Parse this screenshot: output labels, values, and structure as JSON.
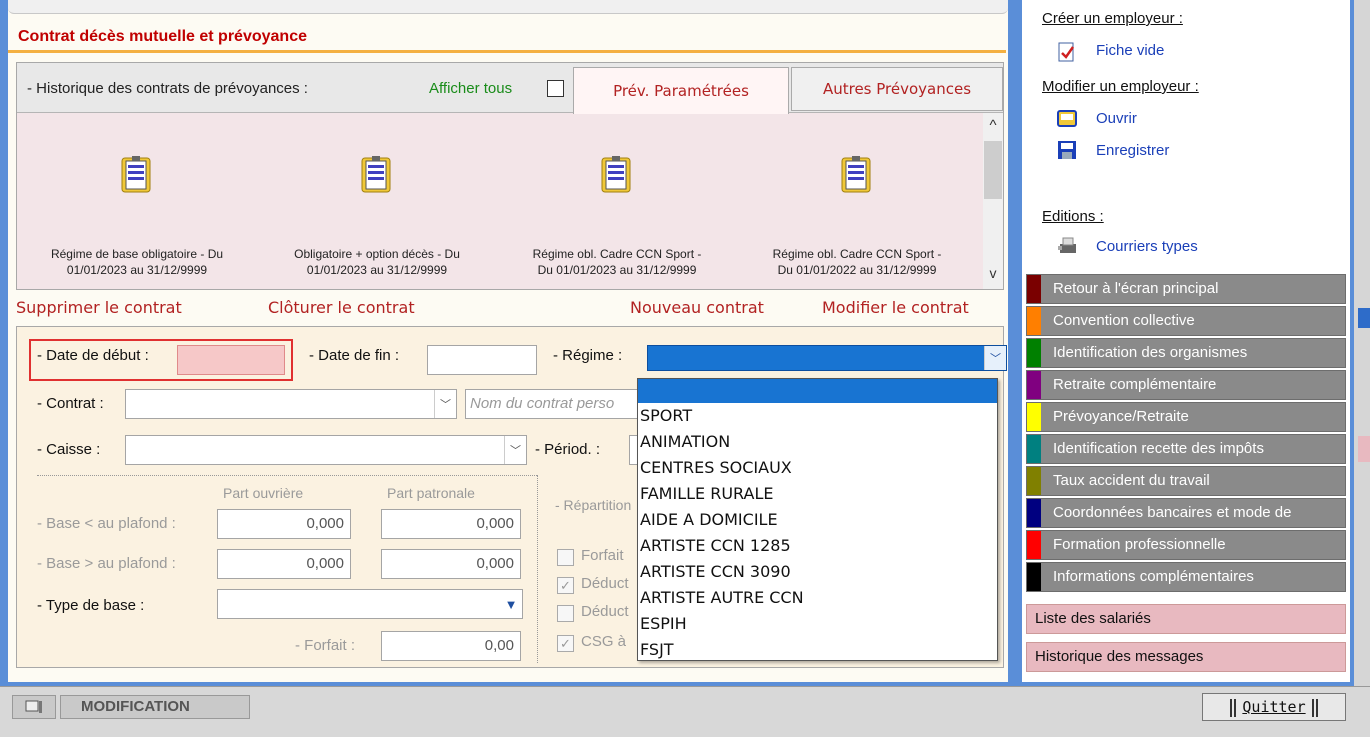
{
  "section": {
    "title": "Contrat décès mutuelle et prévoyance"
  },
  "history": {
    "label": "- Historique des contrats de prévoyances :",
    "afficher_tous": "Afficher tous",
    "tabs": [
      "Prév. Paramétrées",
      "Autres Prévoyances"
    ],
    "docs": [
      {
        "line1": "Régime de base obligatoire - Du",
        "line2": "01/01/2023 au 31/12/9999"
      },
      {
        "line1": "Obligatoire + option décès - Du",
        "line2": "01/01/2023 au 31/12/9999"
      },
      {
        "line1": "Régime obl. Cadre CCN Sport -",
        "line2": "Du 01/01/2023 au 31/12/9999"
      },
      {
        "line1": "Régime obl. Cadre CCN Sport -",
        "line2": "Du 01/01/2022 au 31/12/9999"
      }
    ],
    "scroll_up": "^",
    "scroll_down": "v"
  },
  "actions": {
    "supprimer": "Supprimer le contrat",
    "cloturer": "Clôturer le contrat",
    "nouveau": "Nouveau contrat",
    "modifier": "Modifier le contrat"
  },
  "form": {
    "date_debut": "- Date de début :",
    "date_fin": "- Date de fin :",
    "regime": "- Régime :",
    "contrat": "- Contrat :",
    "contrat_placeholder": "Nom du contrat perso",
    "caisse": "- Caisse :",
    "period": "- Périod. :",
    "part_ouvriere": "Part ouvrière",
    "part_patronale": "Part patronale",
    "repartition": "- Répartition",
    "base_inf": "- Base < au plafond :",
    "base_sup": "- Base > au plafond :",
    "v1": "0,000",
    "v2": "0,000",
    "v3": "0,000",
    "v4": "0,000",
    "type_base": "- Type de base :",
    "forfait": "- Forfait :",
    "forfait_value": "0,00",
    "cb_forfait": "Forfait",
    "cb_deduct1": "Déduct",
    "cb_deduct2": "Déduct",
    "cb_csg": "CSG à",
    "check_mark": "✓"
  },
  "dropdown": {
    "options": [
      "SPORT",
      "ANIMATION",
      "CENTRES SOCIAUX",
      "FAMILLE RURALE",
      "AIDE A DOMICILE",
      "ARTISTE CCN 1285",
      "ARTISTE CCN 3090",
      "ARTISTE AUTRE CCN",
      "ESPIH",
      "FSJT"
    ]
  },
  "sidebar": {
    "creer": "Créer un employeur :",
    "fiche_vide": "Fiche vide",
    "modifier": "Modifier un employeur :",
    "ouvrir": "Ouvrir",
    "enregistrer": "Enregistrer",
    "editions": "Editions :",
    "courriers": "Courriers types",
    "menu": [
      {
        "label": "Retour à l'écran principal",
        "color": "#7a0000"
      },
      {
        "label": "Convention collective",
        "color": "#ff7f00"
      },
      {
        "label": "Identification des organismes",
        "color": "#008000"
      },
      {
        "label": "Retraite complémentaire",
        "color": "#800080"
      },
      {
        "label": "Prévoyance/Retraite",
        "color": "#ffff00"
      },
      {
        "label": "Identification recette des impôts",
        "color": "#008080"
      },
      {
        "label": "Taux accident du travail",
        "color": "#808000"
      },
      {
        "label": "Coordonnées bancaires et mode de",
        "color": "#000080"
      },
      {
        "label": "Formation professionnelle",
        "color": "#ff0000"
      },
      {
        "label": "Informations complémentaires",
        "color": "#000000"
      }
    ],
    "liste_salaries": "Liste des salariés",
    "historique_messages": "Historique des messages"
  },
  "status": {
    "mode": "MODIFICATION",
    "quit": "Quitter"
  }
}
